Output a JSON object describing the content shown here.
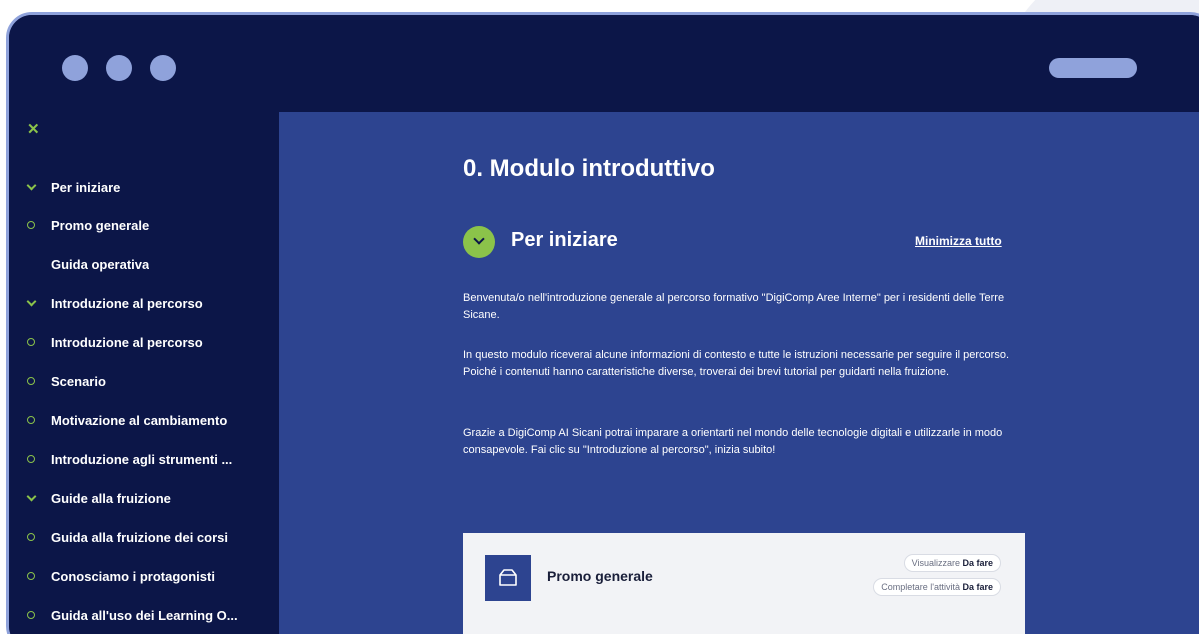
{
  "sidebar": {
    "items": [
      {
        "label": "Per iniziare",
        "icon": "chevron"
      },
      {
        "label": "Promo generale",
        "icon": "circle"
      },
      {
        "label": "Guida operativa",
        "icon": "none"
      },
      {
        "label": "Introduzione al percorso",
        "icon": "chevron"
      },
      {
        "label": "Introduzione al percorso",
        "icon": "circle"
      },
      {
        "label": "Scenario",
        "icon": "circle"
      },
      {
        "label": "Motivazione al cambiamento",
        "icon": "circle"
      },
      {
        "label": "Introduzione agli strumenti ...",
        "icon": "circle"
      },
      {
        "label": "Guide alla fruizione",
        "icon": "chevron"
      },
      {
        "label": "Guida alla fruizione dei corsi",
        "icon": "circle"
      },
      {
        "label": "Conosciamo i protagonisti",
        "icon": "circle"
      },
      {
        "label": "Guida all'uso dei Learning O...",
        "icon": "circle"
      }
    ]
  },
  "main": {
    "title": "0. Modulo introduttivo",
    "section_title": "Per iniziare",
    "collapse_all_label": "Minimizza tutto",
    "paragraphs": [
      "Benvenuta/o nell'introduzione generale al percorso formativo \"DigiComp Aree Interne\" per i residenti delle Terre Sicane.",
      "In questo modulo riceverai alcune informazioni di contesto e tutte le istruzioni necessarie per seguire il percorso. Poiché i contenuti hanno caratteristiche diverse, troverai dei brevi tutorial per guidarti nella fruizione.",
      "Grazie a DigiComp AI Sicani potrai imparare a orientarti nel mondo delle tecnologie digitali e utilizzarle in modo consapevole. Fai clic su \"Introduzione al percorso\", inizia subito!"
    ],
    "activity": {
      "title": "Promo generale",
      "view_label": "Visualizzare",
      "view_status": "Da fare",
      "complete_label": "Completare l'attività",
      "complete_status": "Da fare"
    }
  },
  "colors": {
    "window_bg": "#0c1648",
    "content_bg": "#2d4490",
    "accent_green": "#8bc34a",
    "frame": "#8fa2db"
  }
}
